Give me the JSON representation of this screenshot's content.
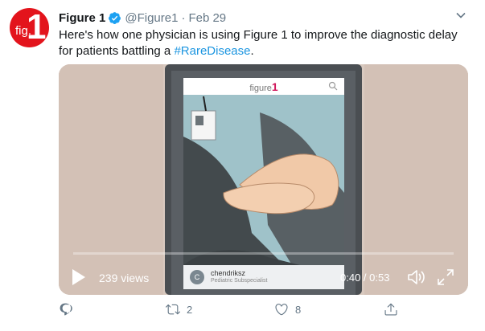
{
  "account": {
    "avatar_text_small": "fig.",
    "avatar_text_large": "1",
    "name": "Figure 1",
    "handle": "@Figure1",
    "separator": "·",
    "date": "Feb 29"
  },
  "tweet": {
    "text_before": "Here's how one physician is using Figure 1 to improve the diagnostic delay for patients battling a ",
    "hashtag": "#RareDisease",
    "text_after": "."
  },
  "video": {
    "app_logo_text": "figure",
    "app_logo_num": "1",
    "card_avatar_letter": "C",
    "card_name": "chendriksz",
    "card_subtitle": "Pediatric Subspecialist",
    "views": "239 views",
    "time": "0:40 / 0:53",
    "progress_fraction": 0.0
  },
  "actions": {
    "reply_count": "",
    "retweet_count": "2",
    "like_count": "8"
  },
  "colors": {
    "brand_red": "#e3141c",
    "link_blue": "#1b95e0",
    "verified_blue": "#1da1f2",
    "meta_gray": "#657786"
  },
  "icons": {
    "verified": "verified-badge-icon",
    "caret": "chevron-down-icon",
    "play": "play-icon",
    "volume": "volume-icon",
    "fullscreen": "fullscreen-icon",
    "reply": "reply-icon",
    "retweet": "retweet-icon",
    "like": "heart-icon",
    "share": "share-icon"
  }
}
